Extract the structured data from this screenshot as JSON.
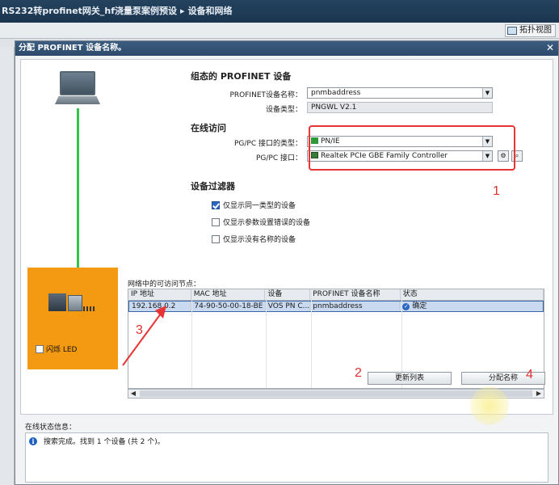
{
  "app": {
    "breadcrumb": [
      "RS232转profinet网关_hf浇量泵案例预设",
      "设备和网络"
    ],
    "breadcrumb_sep": "▸",
    "topology_view": "拓扑视图"
  },
  "dialog": {
    "title": "分配 PROFINET 设备名称。",
    "close": "✕",
    "flash_led": "闪烁 LED",
    "configured": {
      "heading": "组态的 PROFINET 设备",
      "name_label": "PROFINET设备名称：",
      "name_value": "pnmbaddress",
      "type_label": "设备类型：",
      "type_value": "PNGWL V2.1"
    },
    "online": {
      "heading": "在线访问",
      "iface_type_label": "PG/PC 接口的类型：",
      "iface_type_value": "PN/IE",
      "iface_label": "PG/PC 接口：",
      "iface_value": "Realtek PCIe GBE Family Controller"
    },
    "filter": {
      "heading": "设备过滤器",
      "opt1": "仅显示同一类型的设备",
      "opt2": "仅显示参数设置错误的设备",
      "opt3": "仅显示没有名称的设备",
      "opt1_checked": true,
      "opt2_checked": false,
      "opt3_checked": false
    },
    "table": {
      "caption": "网络中的可访问节点：",
      "headers": [
        "IP 地址",
        "MAC 地址",
        "设备",
        "PROFINET 设备名称",
        "状态"
      ],
      "rows": [
        [
          "192.168.0.2",
          "74-90-50-00-18-BE",
          "VOS PN C...",
          "pnmbaddress",
          "确定"
        ]
      ]
    },
    "buttons": {
      "update_list": "更新列表",
      "assign_name": "分配名称"
    },
    "status": {
      "label": "在线状态信息：",
      "message": "搜索完成。找到 1 个设备 (共 2 个)。"
    },
    "annotations": [
      "1",
      "2",
      "3",
      "4"
    ]
  },
  "colors": {
    "annotation_red": "#e83434",
    "device_box": "#f39a12",
    "link_green": "#33c24a"
  }
}
